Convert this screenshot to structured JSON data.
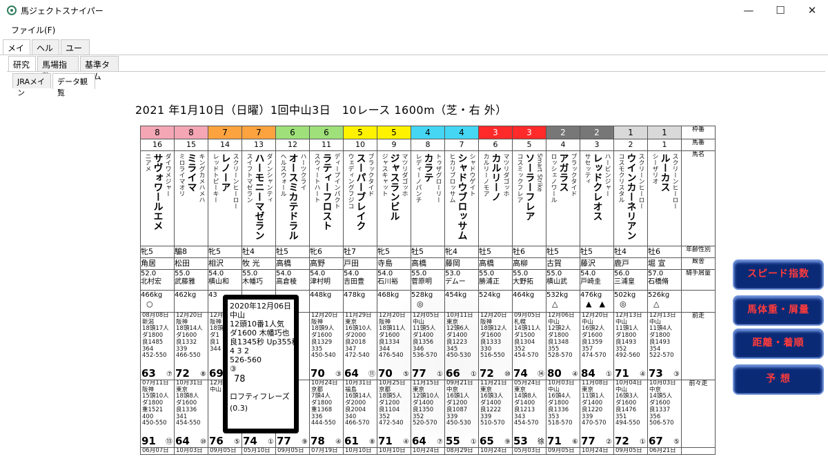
{
  "window": {
    "title": "馬ジェクトスナイパー",
    "minimize": "—",
    "maximize": "☐",
    "close": "✕"
  },
  "menu": {
    "file": "ファイル(F)"
  },
  "tabs1": [
    "メイン",
    "ヘルプ",
    "ユーザ"
  ],
  "tabs2": [
    "研究",
    "馬場指数",
    "基準タイム"
  ],
  "tabs3": [
    "JRAメイン",
    "データ観覧"
  ],
  "race_title": "2021 年1月10日（日曜）1回中山3日　10レース 1600m（芝・右 外）",
  "row_labels": {
    "waku": "枠番",
    "uma": "馬番",
    "name": "馬名",
    "sexage": "年齢性別",
    "stable": "厩舎",
    "jockey": "騎手屑量",
    "prev1": "前走",
    "prev2": "前々走"
  },
  "horses": [
    {
      "waku": "8",
      "wakucolor": "#f4a6b4",
      "uma": "16",
      "name": "サヴォワールエメ",
      "sire": "ダイワメジャー",
      "dam": "ニアメ",
      "sexage": "牝5",
      "stable": "角居",
      "kin": "52.0",
      "jockey": "北村宏",
      "weight": "466kg",
      "mark": "○",
      "p1": {
        "lines": [
          "08月08日",
          "新潟",
          "18頭17人",
          "ダ1800",
          "良1485",
          "364",
          "452-550"
        ],
        "score": "63",
        "place": "⑦"
      },
      "p2": {
        "lines": [
          "07月11日",
          "阪神",
          "15頭10人",
          "ダ1800",
          "重1521",
          "400",
          "450-550"
        ],
        "score": "91",
        "place": "⑬"
      },
      "p3": "06月07日"
    },
    {
      "waku": "8",
      "wakucolor": "#f4a6b4",
      "uma": "15",
      "name": "ミライマ",
      "sire": "キングカメハメハ",
      "dam": "ミロライマオリ",
      "sexage": "騸8",
      "stable": "松田",
      "kin": "55.0",
      "jockey": "武藤雅",
      "weight": "462kg",
      "mark": "",
      "p1": {
        "lines": [
          "12月20日",
          "阪神",
          "18頭14人",
          "ダ1600",
          "良1332",
          "339",
          "466-550"
        ],
        "score": "72",
        "place": "⑧"
      },
      "p2": {
        "lines": [
          "10月31日",
          "東京",
          "18頭8人",
          "ダ1600",
          "良1336",
          "341",
          "454-550"
        ],
        "score": "64",
        "place": "⑩"
      },
      "p3": "10月03日"
    },
    {
      "waku": "7",
      "wakucolor": "#fca340",
      "uma": "14",
      "name": "レノーア",
      "sire": "スクリーンヒーロー",
      "dam": "レッドトピーキー",
      "sexage": "牝5",
      "stable": "相沢",
      "kin": "54.0",
      "jockey": "横山和",
      "weight": "43",
      "mark": "",
      "p1": {
        "lines": [
          "12月20日",
          "阪神",
          "18頭",
          "ダ1",
          "良1",
          "344",
          ""
        ],
        "score": "69",
        "place": ""
      },
      "p2": {
        "lines": [
          "12月20日",
          "中山",
          "",
          "",
          "",
          "",
          ""
        ],
        "score": "76",
        "place": "⑤"
      },
      "p3": "09月05日"
    },
    {
      "waku": "7",
      "wakucolor": "#fca340",
      "uma": "13",
      "name": "ハーモニーマゼラン",
      "sire": "ダノンシャンティ",
      "dam": "スイフトマゼラン",
      "sexage": "牡4",
      "stable": "牧 光",
      "kin": "55.0",
      "jockey": "木幡巧",
      "weight": "",
      "mark": "",
      "p1": {
        "lines": [
          "",
          "",
          "",
          "",
          "",
          "",
          ""
        ],
        "score": "",
        "place": ""
      },
      "p2": {
        "lines": [
          "",
          "",
          "",
          "",
          "",
          "",
          ""
        ],
        "score": "74",
        "place": "①"
      },
      "p3": "05月10日"
    },
    {
      "waku": "6",
      "wakucolor": "#9fe07a",
      "uma": "12",
      "name": "オースミカテドラル",
      "sire": "ハーツクライ",
      "dam": "ヘルスウォール",
      "sexage": "牡5",
      "stable": "高橋",
      "kin": "54.0",
      "jockey": "高倉稜",
      "weight": "",
      "mark": "",
      "p1": {
        "lines": [
          "",
          "",
          "",
          "",
          "",
          "",
          ""
        ],
        "score": "",
        "place": ""
      },
      "p2": {
        "lines": [
          "",
          "",
          "",
          "",
          "",
          "",
          ""
        ],
        "score": "77",
        "place": "⑨"
      },
      "p3": "09月05日"
    },
    {
      "waku": "6",
      "wakucolor": "#9fe07a",
      "uma": "11",
      "name": "ラティーフロスト",
      "sire": "ディープインパクト",
      "dam": "スウィートハート",
      "sexage": "牝6",
      "stable": "高野",
      "kin": "54.0",
      "jockey": "津村明",
      "weight": "448kg",
      "mark": "",
      "p1": {
        "lines": [
          "12月20日",
          "阪神",
          "18頭9人",
          "ダ1600",
          "良1329",
          "335",
          "450-540"
        ],
        "score": "70",
        "place": "③"
      },
      "p2": {
        "lines": [
          "10月24日",
          "京都",
          "7頭4人",
          "ダ1800",
          "重1368",
          "336",
          "444-550"
        ],
        "score": "78",
        "place": "④"
      },
      "p3": "07月19日"
    },
    {
      "waku": "5",
      "wakucolor": "#fff200",
      "uma": "10",
      "name": "スーパーブレイク",
      "sire": "ブラックタイド",
      "dam": "ウェディングフジコ",
      "sexage": "牡7",
      "stable": "戸田",
      "kin": "54.0",
      "jockey": "吉田豊",
      "weight": "478kg",
      "mark": "",
      "p1": {
        "lines": [
          "11月29日",
          "東京",
          "16頭10人",
          "ダ2000",
          "良2018",
          "347",
          "472-540"
        ],
        "score": "64",
        "place": "⑪"
      },
      "p2": {
        "lines": [
          "10月31日",
          "福島",
          "16頭14人",
          "ダ2000",
          "良2004",
          "340",
          "466-570"
        ],
        "score": "61",
        "place": "⑧"
      },
      "p3": "10月10日"
    },
    {
      "waku": "5",
      "wakucolor": "#fff200",
      "uma": "9",
      "name": "ジャスランビル",
      "sire": "マツリダゴッホ",
      "dam": "ジャスキャット",
      "sexage": "牝5",
      "stable": "寺島",
      "kin": "54.0",
      "jockey": "石川裕",
      "weight": "468kg",
      "mark": "",
      "p1": {
        "lines": [
          "12月20日",
          "阪神",
          "18頭11人",
          "ダ1600",
          "良1334",
          "344",
          "476-540"
        ],
        "score": "70",
        "place": "⑤"
      },
      "p2": {
        "lines": [
          "10月25日",
          "京都",
          "18頭5人",
          "ダ1200",
          "良1104",
          "352",
          "472-540"
        ],
        "score": "71",
        "place": "④"
      },
      "p3": "10月10日"
    },
    {
      "waku": "4",
      "wakucolor": "#45d6f4",
      "uma": "8",
      "name": "カラテ",
      "sire": "トゥザグローリー",
      "dam": "レディーノパンチ",
      "sexage": "牡5",
      "stable": "高橋",
      "kin": "55.0",
      "jockey": "菅原明",
      "weight": "528kg",
      "mark": "◎",
      "p1": {
        "lines": [
          "12月05日",
          "中山",
          "11頭5人",
          "ダ1400",
          "良1356",
          "346",
          "536-570"
        ],
        "score": "77",
        "place": "①"
      },
      "p2": {
        "lines": [
          "11月15日",
          "東京",
          "12頭10人",
          "ダ1400",
          "良1350",
          "352",
          "520-570"
        ],
        "score": "64",
        "place": "⑦"
      },
      "p3": "10月24日"
    },
    {
      "waku": "4",
      "wakucolor": "#45d6f4",
      "uma": "7",
      "name": "シャドウブロッサム",
      "sire": "シャドウゲイト",
      "dam": "ヒカリブロッサム",
      "sexage": "牝4",
      "stable": "藤岡",
      "kin": "53.0",
      "jockey": "デムー",
      "weight": "454kg",
      "mark": "",
      "p1": {
        "lines": [
          "10月11日",
          "東京",
          "12頭6人",
          "ダ1400",
          "良1223",
          "345",
          "450-530"
        ],
        "score": "66",
        "place": "①"
      },
      "p2": {
        "lines": [
          "09月21日",
          "中京",
          "16頭1人",
          "ダ1200",
          "良1087",
          "339",
          "450-530"
        ],
        "score": "55",
        "place": "①"
      },
      "p3": "08月29日"
    },
    {
      "waku": "3",
      "wakucolor": "#ff2a2a",
      "uma": "6",
      "name": "カルリーノ",
      "sire": "マツリダゴッホ",
      "dam": "カルリーノモア",
      "sexage": "牡5",
      "stable": "高橋",
      "kin": "55.0",
      "jockey": "勝浦正",
      "weight": "524kg",
      "mark": "",
      "p1": {
        "lines": [
          "12月20日",
          "阪神",
          "18頭12人",
          "ダ1600",
          "良1333",
          "330",
          "516-550"
        ],
        "score": "72",
        "place": "⑩"
      },
      "p2": {
        "lines": [
          "11月21日",
          "東京",
          "16頭3人",
          "ダ1400",
          "良1222",
          "339",
          "510-570"
        ],
        "score": "65",
        "place": "⑨"
      },
      "p3": "10月24日"
    },
    {
      "waku": "3",
      "wakucolor": "#ff2a2a",
      "uma": "5",
      "name": "ソーラーフレア",
      "sire": "Smart Strike",
      "dam": "コスミックフレア",
      "sexage": "牡6",
      "stable": "高柳",
      "kin": "55.0",
      "jockey": "大野拓",
      "weight": "464kg",
      "mark": "",
      "p1": {
        "lines": [
          "09月05日",
          "札幌",
          "14頭11人",
          "ダ1500",
          "良1304",
          "352",
          "454-570"
        ],
        "score": "74",
        "place": "⑭"
      },
      "p2": {
        "lines": [
          "05月24日",
          "東京",
          "14頭8人",
          "ダ1400",
          "良1213",
          "343",
          "454-570"
        ],
        "score": "53",
        "place": "徐"
      },
      "p3": "05月03日"
    },
    {
      "waku": "2",
      "wakucolor": "#777777",
      "uma": "4",
      "name": "アガラス",
      "sire": "ブラックタイド",
      "dam": "ロッシェノワール",
      "sexage": "牡5",
      "stable": "古賀",
      "kin": "55.0",
      "jockey": "横山武",
      "weight": "532kg",
      "mark": "△",
      "p1": {
        "lines": [
          "12月06日",
          "中山",
          "12頭2人",
          "ダ1800",
          "良1348",
          "355",
          "528-570"
        ],
        "score": "80",
        "place": "④"
      },
      "p2": {
        "lines": [
          "10月03日",
          "中山",
          "16頭4人",
          "ダ1800",
          "良1336",
          "353",
          "518-570"
        ],
        "score": "71",
        "place": "⑥"
      },
      "p3": "09月05日"
    },
    {
      "waku": "2",
      "wakucolor": "#777777",
      "uma": "3",
      "name": "レッドクレオス",
      "sire": "ハービンジャー",
      "dam": "サセッティ",
      "sexage": "牡5",
      "stable": "藤沢",
      "kin": "54.0",
      "jockey": "戸崎圭",
      "weight": "476kg",
      "mark": "▲　▲",
      "p1": {
        "lines": [
          "12月20日",
          "中山",
          "16頭2人",
          "ダ1600",
          "良1359",
          "357",
          "474-570"
        ],
        "score": "84",
        "place": "①"
      },
      "p2": {
        "lines": [
          "11月08日",
          "東京",
          "11頭1人",
          "ダ1400",
          "良1220",
          "339",
          "470-570"
        ],
        "score": "77",
        "place": "②"
      },
      "p3": "10月24日"
    },
    {
      "waku": "1",
      "wakucolor": "#d9d9d9",
      "uma": "2",
      "name": "ウインカーネリアン",
      "sire": "スクリーンヒーロー",
      "dam": "コスモクリスタル",
      "sexage": "牡4",
      "stable": "鹿戸",
      "kin": "56.0",
      "jockey": "三浦皇",
      "weight": "502kg",
      "mark": "◎",
      "p1": {
        "lines": [
          "12月13日",
          "中山",
          "11頭1人",
          "ダ1800",
          "良1493",
          "352",
          "492-560"
        ],
        "score": "71",
        "place": "④"
      },
      "p2": {
        "lines": [
          "10月04日",
          "中山",
          "16頭3人",
          "ダ1600",
          "良1476",
          "351",
          "494-550"
        ],
        "score": "72",
        "place": "①"
      },
      "p3": "09月05日"
    },
    {
      "waku": "1",
      "wakucolor": "#d9d9d9",
      "uma": "1",
      "name": "ルーカス",
      "sire": "スクリーンヒーロー",
      "dam": "シーザリオ",
      "sexage": "牡6",
      "stable": "堀 宣",
      "kin": "57.0",
      "jockey": "石橋脩",
      "weight": "526kg",
      "mark": "△",
      "p1": {
        "lines": [
          "12月13日",
          "中山",
          "11頭4人",
          "ダ1800",
          "良1493",
          "354",
          "522-570"
        ],
        "score": "73",
        "place": "③"
      },
      "p2": {
        "lines": [
          "10月03日",
          "中京",
          "14頭5人",
          "ダ1600",
          "良1337",
          "356",
          "506-570"
        ],
        "score": "67",
        "place": "⑤"
      },
      "p3": "06月21日"
    }
  ],
  "buttons": {
    "speed": "スピード指数",
    "weight": "馬体重・屑量",
    "distance": "距離・着順",
    "forecast": "予 想"
  },
  "popup": {
    "date": "2020年12月06日",
    "course": "中山",
    "info": "12頭10番1人気",
    "dist": "ダ1600 木幡巧也",
    "time": "良1345秒 Up355秒",
    "pos": "4 3 2",
    "weight": "526-560",
    "place": "③",
    "score": "78",
    "horse": "ロフティフレーズ",
    "diff": "(0.3)"
  }
}
